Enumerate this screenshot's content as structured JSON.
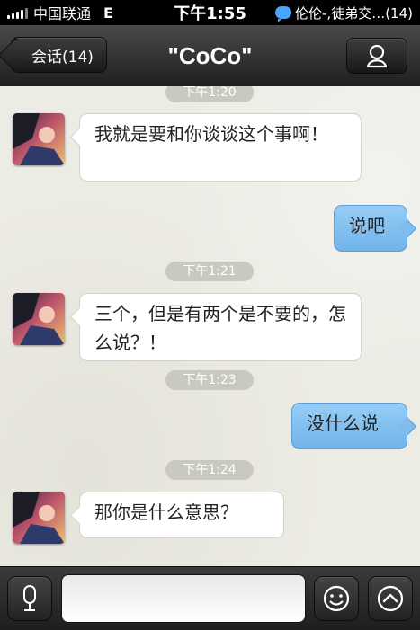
{
  "status_bar": {
    "carrier": "中国联通",
    "network": "E",
    "time": "下午1:55",
    "notification": "伦伦-,徒弟交…(14)"
  },
  "nav": {
    "back_label": "会话(14)",
    "title": "\"CoCo\""
  },
  "messages": [
    {
      "type": "timestamp",
      "text": "下午1:20"
    },
    {
      "type": "incoming",
      "text": "我就是要和你谈谈这个事啊！"
    },
    {
      "type": "outgoing",
      "text": "说吧"
    },
    {
      "type": "timestamp",
      "text": "下午1:21"
    },
    {
      "type": "incoming",
      "text": "三个，但是有两个是不要的，怎么说？！"
    },
    {
      "type": "timestamp",
      "text": "下午1:23"
    },
    {
      "type": "outgoing",
      "text": "没什么说"
    },
    {
      "type": "timestamp",
      "text": "下午1:24"
    },
    {
      "type": "incoming",
      "text": "那你是什么意思？"
    }
  ],
  "input": {
    "value": "",
    "voice_icon": "microphone-icon",
    "emoji_icon": "smiley-icon",
    "more_icon": "chevron-up-icon"
  },
  "colors": {
    "outgoing_bubble": "#80bdee",
    "incoming_bubble": "#ffffff",
    "chat_background": "#ecebe4"
  }
}
